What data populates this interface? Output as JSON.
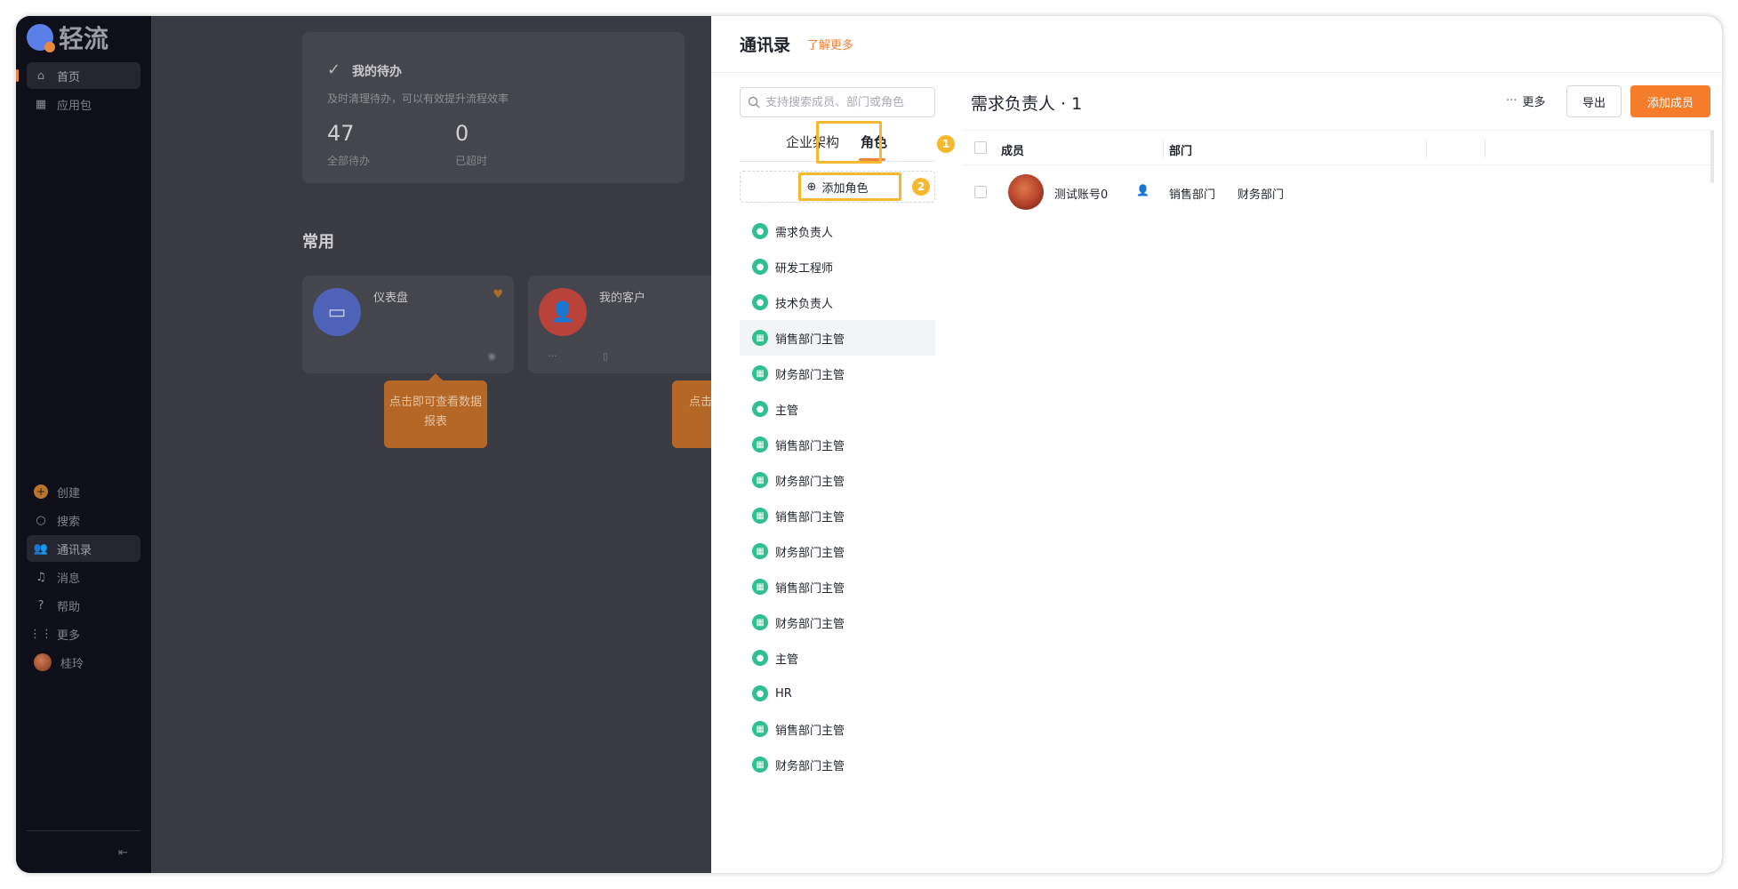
{
  "app": {
    "logo_text": "轻流"
  },
  "nav": {
    "top_items": [
      {
        "label": "首页",
        "icon": "home-icon"
      },
      {
        "label": "应用包",
        "icon": "grid-icon"
      }
    ],
    "bottom_items": [
      {
        "label": "创建",
        "icon": "plus-icon"
      },
      {
        "label": "搜索",
        "icon": "search-icon"
      },
      {
        "label": "通讯录",
        "icon": "contacts-icon"
      },
      {
        "label": "消息",
        "icon": "bell-icon"
      },
      {
        "label": "帮助",
        "icon": "help-icon"
      },
      {
        "label": "更多",
        "icon": "apps-icon"
      },
      {
        "label": "桂玲",
        "icon": "avatar"
      }
    ]
  },
  "main": {
    "todo_title": "我的待办",
    "todo_subtitle": "及时清理待办，可以有效提升流程效率",
    "stats": [
      {
        "value": "47",
        "label": "全部待办"
      },
      {
        "value": "0",
        "label": "已超时"
      }
    ],
    "section_title": "常用",
    "apps": [
      {
        "name": "仪表盘"
      },
      {
        "name": "我的客户"
      }
    ],
    "tips": [
      "点击即可查看数据报表",
      "点击即编辑应"
    ]
  },
  "drawer": {
    "title": "通讯录",
    "learn_more": "了解更多",
    "search_placeholder": "支持搜索成员、部门或角色",
    "tabs": [
      "企业架构",
      "角色"
    ],
    "add_role": "添加角色",
    "badges": [
      "1",
      "2"
    ],
    "roles": [
      "需求负责人",
      "研发工程师",
      "技术负责人",
      "销售部门主管",
      "财务部门主管",
      "主管",
      "销售部门主管",
      "财务部门主管",
      "销售部门主管",
      "财务部门主管",
      "销售部门主管",
      "财务部门主管",
      "主管",
      "HR",
      "销售部门主管",
      "财务部门主管"
    ],
    "selected_role_index": 3,
    "right_title": "需求负责人 · 1",
    "more_label": "更多",
    "export_label": "导出",
    "add_member_label": "添加成员",
    "columns": [
      "成员",
      "部门"
    ],
    "members": [
      {
        "name": "测试账号0",
        "depts": [
          "销售部门",
          "财务部门"
        ]
      }
    ]
  },
  "colors": {
    "accent": "#f57c2a",
    "highlight": "#f5b82e",
    "role_icon": "#2fbe8d"
  }
}
